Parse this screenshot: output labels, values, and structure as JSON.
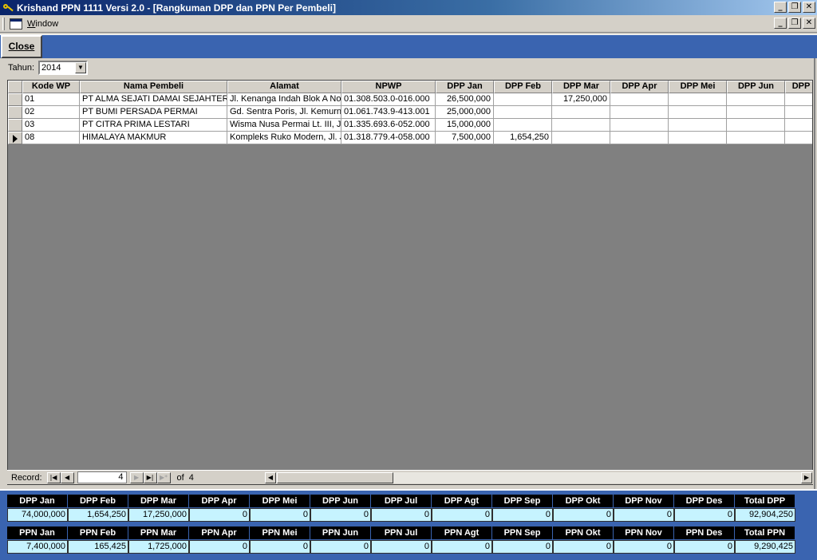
{
  "window": {
    "title": "Krishand PPN 1111 Versi 2.0 - [Rangkuman DPP dan PPN Per Pembeli]",
    "minimize": "_",
    "restore": "❐",
    "close": "✕"
  },
  "menu": {
    "window_label_first": "W",
    "window_label_rest": "indow"
  },
  "toolbar": {
    "close_label": "Close"
  },
  "filter": {
    "tahun_label": "Tahun:",
    "tahun_value": "2014"
  },
  "grid": {
    "columns": [
      "Kode WP",
      "Nama Pembeli",
      "Alamat",
      "NPWP",
      "DPP Jan",
      "DPP Feb",
      "DPP Mar",
      "DPP Apr",
      "DPP Mei",
      "DPP Jun",
      "DPP"
    ],
    "rows": [
      {
        "kode": "01",
        "nama": "PT ALMA SEJATI DAMAI SEJAHTERA",
        "alamat": "Jl. Kenanga Indah Blok A No.",
        "npwp": "01.308.503.0-016.000",
        "jan": "26,500,000",
        "feb": "",
        "mar": "17,250,000",
        "apr": "",
        "mei": "",
        "jun": ""
      },
      {
        "kode": "02",
        "nama": "PT BUMI PERSADA PERMAI",
        "alamat": "Gd. Sentra Poris, Jl. Kemurni",
        "npwp": "01.061.743.9-413.001",
        "jan": "25,000,000",
        "feb": "",
        "mar": "",
        "apr": "",
        "mei": "",
        "jun": ""
      },
      {
        "kode": "03",
        "nama": "PT CITRA PRIMA LESTARI",
        "alamat": "Wisma Nusa Permai Lt. III, Jl.",
        "npwp": "01.335.693.6-052.000",
        "jan": "15,000,000",
        "feb": "",
        "mar": "",
        "apr": "",
        "mei": "",
        "jun": ""
      },
      {
        "kode": "08",
        "nama": "HIMALAYA MAKMUR",
        "alamat": "Kompleks Ruko Modern, Jl. Je",
        "npwp": "01.318.779.4-058.000",
        "jan": "7,500,000",
        "feb": "1,654,250",
        "mar": "",
        "apr": "",
        "mei": "",
        "jun": ""
      }
    ]
  },
  "navigation": {
    "record_label": "Record:",
    "current": "4",
    "of_label": "of",
    "total": "4",
    "first": "|◀",
    "prev": "◀",
    "next": "▶",
    "last": "▶|",
    "new": "▶*"
  },
  "summary_dpp": {
    "headers": [
      "DPP Jan",
      "DPP Feb",
      "DPP Mar",
      "DPP Apr",
      "DPP Mei",
      "DPP Jun",
      "DPP Jul",
      "DPP Agt",
      "DPP Sep",
      "DPP Okt",
      "DPP Nov",
      "DPP Des",
      "Total DPP"
    ],
    "values": [
      "74,000,000",
      "1,654,250",
      "17,250,000",
      "0",
      "0",
      "0",
      "0",
      "0",
      "0",
      "0",
      "0",
      "0",
      "92,904,250"
    ]
  },
  "summary_ppn": {
    "headers": [
      "PPN Jan",
      "PPN Feb",
      "PPN Mar",
      "PPN Apr",
      "PPN Mei",
      "PPN Jun",
      "PPN Jul",
      "PPN Agt",
      "PPN Sep",
      "PPN Okt",
      "PPN Nov",
      "PPN Des",
      "Total PPN"
    ],
    "values": [
      "7,400,000",
      "165,425",
      "1,725,000",
      "0",
      "0",
      "0",
      "0",
      "0",
      "0",
      "0",
      "0",
      "0",
      "9,290,425"
    ]
  },
  "colors": {
    "title_bar": "#0a246a",
    "toolbar": "#3a64b0",
    "grid_bg": "#808080",
    "summary_value_bg": "#c6f3ff"
  }
}
